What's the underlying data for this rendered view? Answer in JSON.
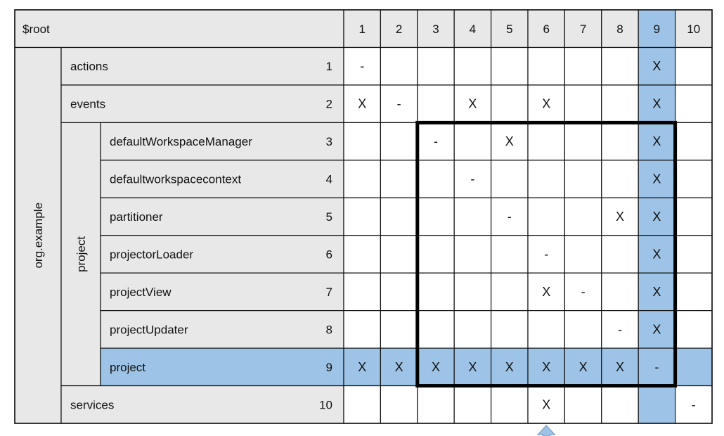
{
  "root_label": "$root",
  "columns": [
    "1",
    "2",
    "3",
    "4",
    "5",
    "6",
    "7",
    "8",
    "9",
    "10"
  ],
  "groups": [
    {
      "label": "org.example",
      "level": 1,
      "first_row": 0,
      "last_row": 9
    },
    {
      "label": "project",
      "level": 2,
      "first_row": 2,
      "last_row": 8
    }
  ],
  "rows": [
    {
      "label": "actions",
      "number": "1",
      "level": 1,
      "cells": [
        "-",
        "",
        "",
        "",
        "",
        "",
        "",
        "",
        "X",
        ""
      ]
    },
    {
      "label": "events",
      "number": "2",
      "level": 1,
      "cells": [
        "X",
        "-",
        "",
        "X",
        "",
        "X",
        "",
        "",
        "X",
        ""
      ]
    },
    {
      "label": "defaultWorkspaceManager",
      "number": "3",
      "level": 2,
      "cells": [
        "",
        "",
        "-",
        "",
        "X",
        "",
        "",
        "",
        "X",
        ""
      ]
    },
    {
      "label": "defaultworkspacecontext",
      "number": "4",
      "level": 2,
      "cells": [
        "",
        "",
        "",
        "-",
        "",
        "",
        "",
        "",
        "X",
        ""
      ]
    },
    {
      "label": "partitioner",
      "number": "5",
      "level": 2,
      "cells": [
        "",
        "",
        "",
        "",
        "-",
        "",
        "",
        "X",
        "X",
        ""
      ]
    },
    {
      "label": "projectorLoader",
      "number": "6",
      "level": 2,
      "cells": [
        "",
        "",
        "",
        "",
        "",
        "-",
        "",
        "",
        "X",
        ""
      ]
    },
    {
      "label": "projectView",
      "number": "7",
      "level": 2,
      "cells": [
        "",
        "",
        "",
        "",
        "",
        "X",
        "-",
        "",
        "X",
        ""
      ]
    },
    {
      "label": "projectUpdater",
      "number": "8",
      "level": 2,
      "cells": [
        "",
        "",
        "",
        "",
        "",
        "",
        "",
        "-",
        "X",
        ""
      ]
    },
    {
      "label": "project",
      "number": "9",
      "level": 2,
      "cells": [
        "X",
        "X",
        "X",
        "X",
        "X",
        "X",
        "X",
        "X",
        "-",
        ""
      ]
    },
    {
      "label": "services",
      "number": "10",
      "level": 1,
      "cells": [
        "",
        "",
        "",
        "",
        "",
        "X",
        "",
        "",
        "",
        "-"
      ]
    }
  ],
  "highlight": {
    "row": 9,
    "column": 9
  },
  "module_box": {
    "from": 3,
    "to": 9
  },
  "arrow_column": 6,
  "colors": {
    "header_fill": "#e8e8e8",
    "highlight_fill": "#9dc3e6",
    "line": "#111111",
    "box": "#000000"
  }
}
